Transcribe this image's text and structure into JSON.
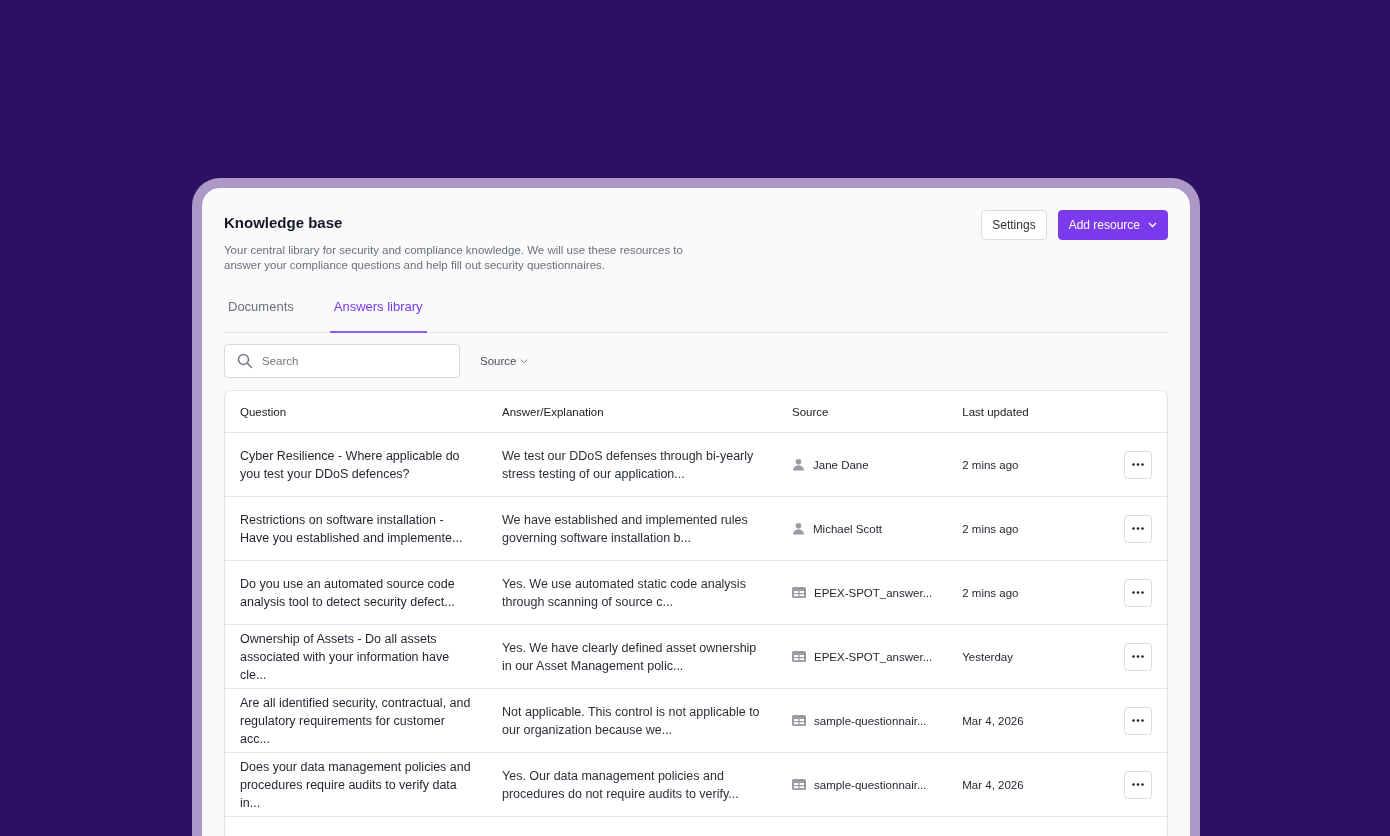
{
  "header": {
    "title": "Knowledge base",
    "description": "Your central library for security and compliance knowledge. We will use these resources to answer your compliance questions and help fill out security questionnaires.",
    "buttons": [
      {
        "label": "Settings",
        "kind": "secondary"
      },
      {
        "label": "Add resource",
        "kind": "primary"
      }
    ]
  },
  "tabs": [
    {
      "label": "Documents",
      "selected": false
    },
    {
      "label": "Answers library",
      "selected": true
    }
  ],
  "search": {
    "placeholder": "Search"
  },
  "filter": {
    "label": "Source"
  },
  "table": {
    "columns": [
      "Question",
      "Answer/Explanation",
      "Source",
      "Last updated"
    ],
    "rows": [
      {
        "question": "Cyber Resilience - Where applicable do you test your DDoS defences?",
        "answer": "We test our DDoS defenses through bi-yearly stress testing of our application...",
        "source": "Jane Dane",
        "kind": "person",
        "updated": "2 mins ago"
      },
      {
        "question": "Restrictions on software installation - Have you established and implemente...",
        "answer": "We have established and implemented rules governing software installation b...",
        "source": "Michael Scott",
        "kind": "person",
        "updated": "2 mins ago"
      },
      {
        "question": "Do you use an automated source code analysis tool to detect security defect...",
        "answer": "Yes. We use automated static code analysis through scanning of source c...",
        "source": "EPEX-SPOT_answer...",
        "kind": "file",
        "updated": "2 mins ago"
      },
      {
        "question": "Ownership of Assets - Do all assets associated with your information have cle...",
        "answer": "Yes. We have clearly defined asset ownership in our Asset Management polic...",
        "source": "EPEX-SPOT_answer...",
        "kind": "file",
        "updated": "Yesterday"
      },
      {
        "question": "Are all identified security, contractual, and regulatory requirements for customer acc...",
        "answer": "Not applicable. This control is not applicable to our organization because we...",
        "source": "sample-questionnair...",
        "kind": "file",
        "updated": "Mar 4, 2026"
      },
      {
        "question": "Does your data management policies and procedures require audits to verify data in...",
        "answer": "Yes. Our data management policies and procedures do not require audits to verify...",
        "source": "sample-questionnair...",
        "kind": "file",
        "updated": "Mar 4, 2026"
      }
    ]
  }
}
